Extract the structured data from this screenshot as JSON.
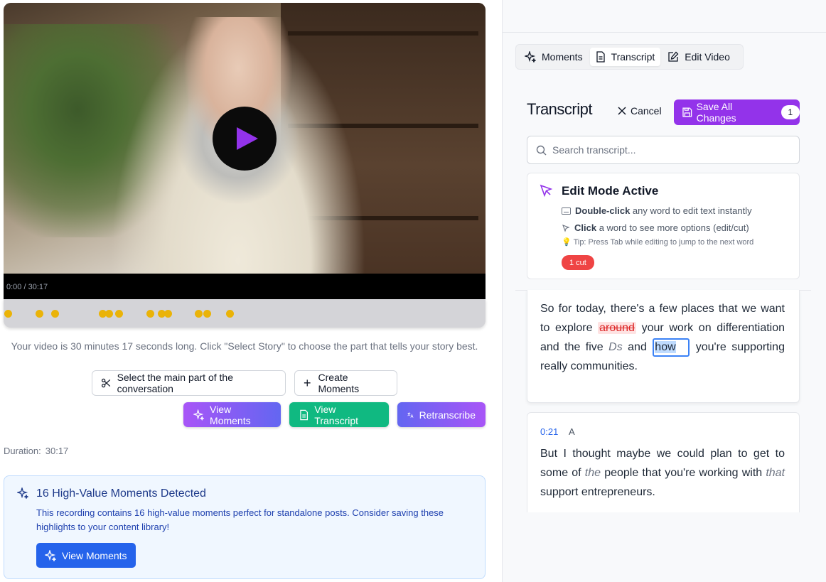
{
  "video": {
    "timecode": "0:00 / 30:17",
    "moment_dots": 13
  },
  "left": {
    "info_text": "Your video is 30 minutes 17 seconds long. Click \"Select Story\" to choose the part that tells your story best.",
    "select_main_label": "Select the main part of the conversation",
    "create_moments_label": "Create Moments",
    "view_moments_label": "View Moments",
    "view_transcript_label": "View Transcript",
    "retranscribe_label": "Retranscribe",
    "duration_label": "Duration:",
    "duration_value": "30:17",
    "high_value": {
      "title": "16 High-Value Moments Detected",
      "body": "This recording contains 16 high-value moments perfect for standalone posts. Consider saving these highlights to your content library!",
      "button_label": "View Moments"
    }
  },
  "right": {
    "tabs": [
      {
        "label": "Moments"
      },
      {
        "label": "Transcript"
      },
      {
        "label": "Edit Video"
      }
    ],
    "title": "Transcript",
    "cancel_label": "Cancel",
    "save_label": "Save All Changes",
    "save_count": "1",
    "search_placeholder": "Search transcript...",
    "edit_mode": {
      "title": "Edit Mode Active",
      "line1_bold": "Double-click",
      "line1_rest": "any word to edit text instantly",
      "line2_bold": "Click",
      "line2_rest": "a word to see more options (edit/cut)",
      "tip": "Tip: Press Tab while editing to jump to the next word",
      "cut_badge": "1 cut"
    },
    "segment1": {
      "w1": "So for today, there's a few places that we want to explore",
      "cut_word": "around",
      "w2": "your work on differentiation and the five",
      "em_word": "Ds",
      "w3": "and",
      "selected_word": "how",
      "w4": "you're supporting really communities."
    },
    "segment2": {
      "timestamp": "0:21",
      "speaker": "A",
      "w1": "But I thought maybe we could plan to get to some of",
      "em1": "the",
      "w2": "people that you're working with",
      "em2": "that",
      "w3": "support entrepreneurs."
    }
  },
  "colors": {
    "accent_purple": "#9333ea",
    "moments_dot": "#eab308",
    "view_transcript": "#10b981",
    "primary_blue": "#2563eb",
    "cut_red": "#ef4444"
  }
}
